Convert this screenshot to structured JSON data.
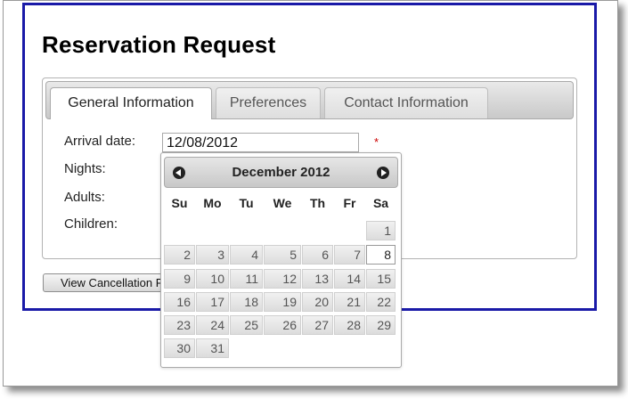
{
  "page": {
    "title": "Reservation Request"
  },
  "tabs": [
    {
      "label": "General Information",
      "active": true
    },
    {
      "label": "Preferences",
      "active": false
    },
    {
      "label": "Contact Information",
      "active": false
    }
  ],
  "form": {
    "arrival_label": "Arrival date:",
    "arrival_value": "12/08/2012",
    "required_mark": "*",
    "nights_label": "Nights:",
    "adults_label": "Adults:",
    "children_label": "Children:"
  },
  "buttons": {
    "view_cancellation": "View Cancellation Policy"
  },
  "datepicker": {
    "month_title": "December 2012",
    "weekdays": [
      "Su",
      "Mo",
      "Tu",
      "We",
      "Th",
      "Fr",
      "Sa"
    ],
    "days": [
      "1",
      "2",
      "3",
      "4",
      "5",
      "6",
      "7",
      "8",
      "9",
      "10",
      "11",
      "12",
      "13",
      "14",
      "15",
      "16",
      "17",
      "18",
      "19",
      "20",
      "21",
      "22",
      "23",
      "24",
      "25",
      "26",
      "27",
      "28",
      "29",
      "30",
      "31"
    ],
    "selected_day": "8",
    "icons": {
      "prev": "circle-triangle-w-icon",
      "next": "circle-triangle-e-icon"
    }
  },
  "colors": {
    "frame_border": "#1a1aa8",
    "required": "#cc0000"
  }
}
